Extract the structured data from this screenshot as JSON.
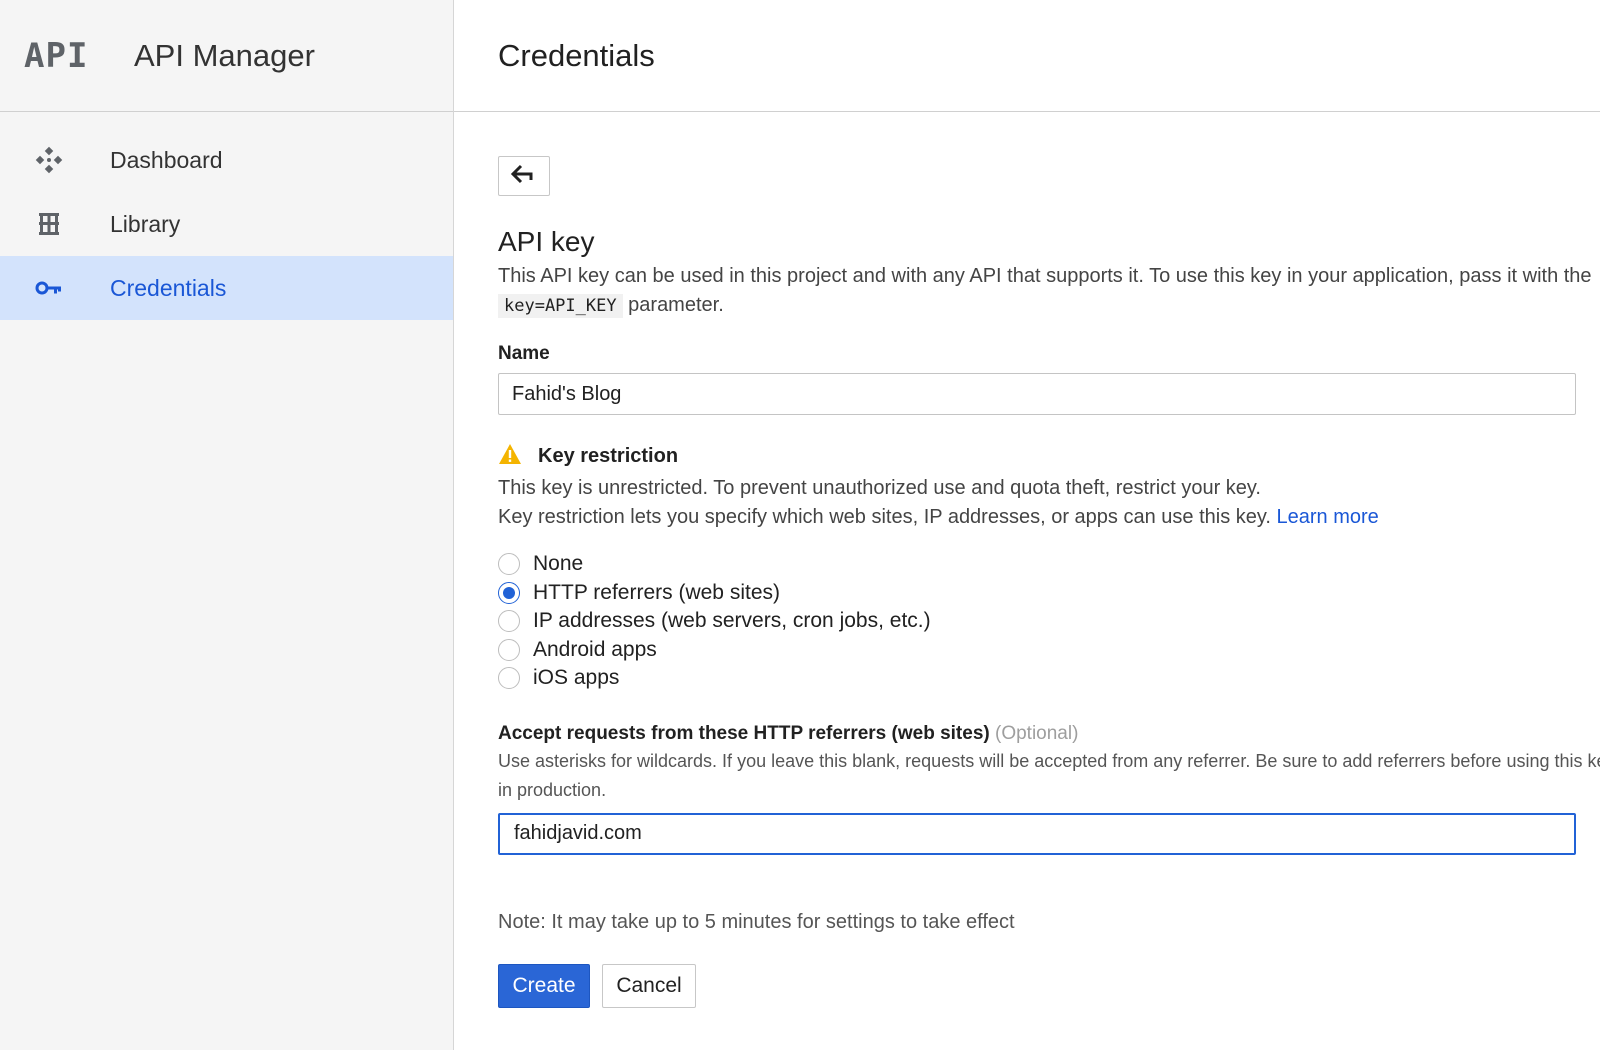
{
  "app": {
    "logo": "API",
    "title": "API Manager"
  },
  "sidebar": {
    "items": [
      {
        "label": "Dashboard",
        "icon": "dashboard-icon",
        "active": false
      },
      {
        "label": "Library",
        "icon": "library-icon",
        "active": false
      },
      {
        "label": "Credentials",
        "icon": "key-icon",
        "active": true
      }
    ]
  },
  "header": {
    "title": "Credentials"
  },
  "form": {
    "back_icon": "back-arrow-icon",
    "section_title": "API key",
    "description_part1": "This API key can be used in this project and with any API that supports it. To use this key in your application, pass it with the",
    "description_code": "key=API_KEY",
    "description_part2": "parameter.",
    "name_label": "Name",
    "name_value": "Fahid's Blog",
    "restriction": {
      "icon": "warning-icon",
      "title": "Key restriction",
      "line1": "This key is unrestricted. To prevent unauthorized use and quota theft, restrict your key.",
      "line2": "Key restriction lets you specify which web sites, IP addresses, or apps can use this key.",
      "learn_more": "Learn more",
      "options": [
        {
          "label": "None",
          "checked": false
        },
        {
          "label": "HTTP referrers (web sites)",
          "checked": true
        },
        {
          "label": "IP addresses (web servers, cron jobs, etc.)",
          "checked": false
        },
        {
          "label": "Android apps",
          "checked": false
        },
        {
          "label": "iOS apps",
          "checked": false
        }
      ]
    },
    "referrers": {
      "label": "Accept requests from these HTTP referrers (web sites)",
      "optional": "(Optional)",
      "description": "Use asterisks for wildcards. If you leave this blank, requests will be accepted from any referrer. Be sure to add referrers before using this key in production.",
      "value": "fahidjavid.com"
    },
    "note": "Note: It may take up to 5 minutes for settings to take effect",
    "create_label": "Create",
    "cancel_label": "Cancel"
  },
  "colors": {
    "accent": "#2162d6",
    "active_nav_bg": "#d3e3fc",
    "warning": "#f4b400"
  }
}
